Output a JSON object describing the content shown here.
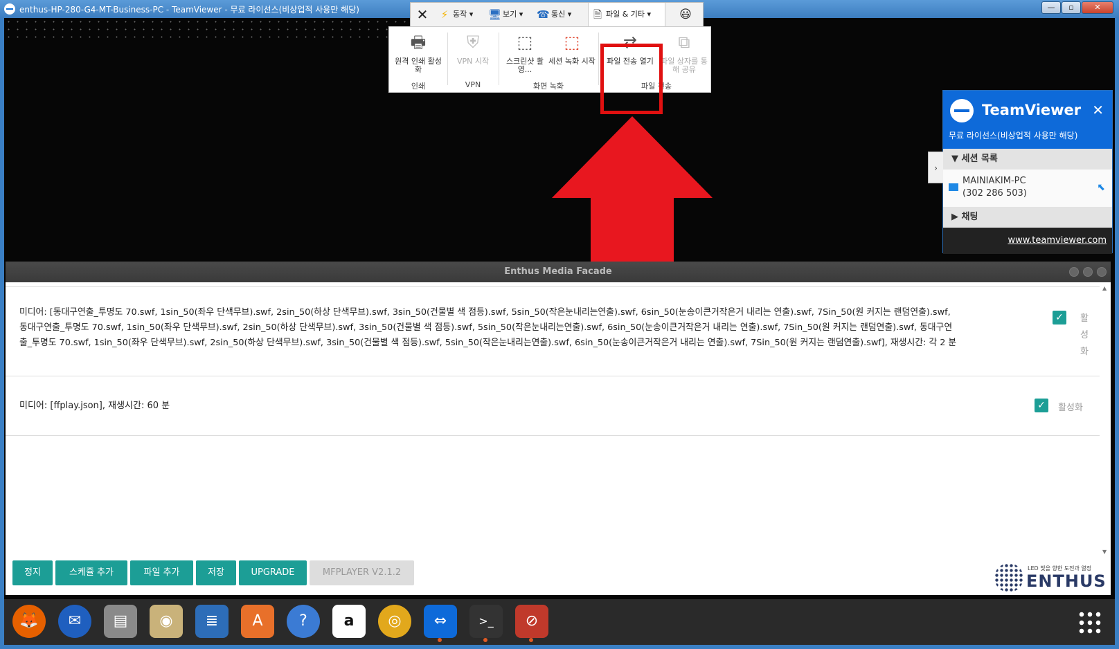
{
  "window": {
    "title": "enthus-HP-280-G4-MT-Business-PC - TeamViewer - 무료 라이선스(비상업적 사용만 해당)",
    "min_label": "—",
    "max_label": "▫",
    "close_label": "✕"
  },
  "toolbar": {
    "close_glyph": "✕",
    "items": [
      {
        "label": "동작",
        "icon": "lightning-icon"
      },
      {
        "label": "보기",
        "icon": "monitor-icon"
      },
      {
        "label": "통신",
        "icon": "phone-icon"
      },
      {
        "label": "파일 & 기타",
        "icon": "file-transfer-icon"
      }
    ],
    "emoji": "😃"
  },
  "ribbon": {
    "items": [
      {
        "label": "원격 인쇄 활성화",
        "icon": "printer-icon",
        "enabled": true
      },
      {
        "label": "VPN 시작",
        "icon": "vpn-shield-icon",
        "enabled": false
      },
      {
        "label": "스크린샷 촬영...",
        "icon": "screenshot-icon",
        "enabled": true
      },
      {
        "label": "세션 녹화 시작",
        "icon": "record-icon",
        "enabled": true
      },
      {
        "label": "파일 전송 열기",
        "icon": "file-transfer-open-icon",
        "enabled": true
      },
      {
        "label": "파일 상자를 통해 공유",
        "icon": "file-box-share-icon",
        "enabled": false
      }
    ],
    "groups": [
      "인쇄",
      "VPN",
      "화면 녹화",
      "파일 전송"
    ]
  },
  "tvpanel": {
    "brand": "TeamViewer",
    "license": "무료 라이선스(비상업적 사용만 해당)",
    "session_list_title": "세션 목록",
    "session_name": "MAINIAKIM-PC",
    "session_id": "(302 286 503)",
    "chat_title": "채팅",
    "url": "www.teamviewer.com"
  },
  "emf": {
    "title": "Enthus Media Facade",
    "rows": [
      {
        "lines": [
          "미디어: [동대구연출_투명도 70.swf, 1sin_50(좌우 단색무브).swf, 2sin_50(하상 단색무브).swf, 3sin_50(건물별 색 점등).swf, 5sin_50(작은눈내리는연출).swf, 6sin_50(눈송이큰거작은거 내리는 연출).swf, 7Sin_50(원 커지는 랜덤연출).swf,",
          "동대구연출_투명도 70.swf, 1sin_50(좌우 단색무브).swf, 2sin_50(하상 단색무브).swf, 3sin_50(건물별 색 점등).swf, 5sin_50(작은눈내리는연출).swf, 6sin_50(눈송이큰거작은거 내리는 연출).swf, 7Sin_50(원 커지는 랜덤연출).swf, 동대구연",
          "출_투명도 70.swf, 1sin_50(좌우 단색무브).swf, 2sin_50(하상 단색무브).swf, 3sin_50(건물별 색 점등).swf, 5sin_50(작은눈내리는연출).swf, 6sin_50(눈송이큰거작은거 내리는 연출).swf, 7Sin_50(원 커지는 랜덤연출).swf], 재생시간: 각 2 분"
        ],
        "active_label": [
          "활",
          "성",
          "화"
        ],
        "checked": true
      },
      {
        "lines": [
          "미디어: [ffplay.json], 재생시간: 60 분"
        ],
        "active_label": "활성화",
        "checked": true
      }
    ],
    "buttons": [
      "정지",
      "스케쥴 추가",
      "파일 추가",
      "저장",
      "UPGRADE"
    ],
    "version": "MFPLAYER V2.1.2",
    "logo_tagline": "LED 빛을 향한 도전과 열정",
    "logo_word": "ENTHUS"
  },
  "dock": {
    "apps": [
      {
        "name": "firefox-icon",
        "glyph": "🦊",
        "color": "#e66000"
      },
      {
        "name": "thunderbird-icon",
        "glyph": "✉",
        "color": "#1f5fbf"
      },
      {
        "name": "files-icon",
        "glyph": "▤",
        "color": "#8a8a8a"
      },
      {
        "name": "rhythmbox-icon",
        "glyph": "◉",
        "color": "#c9b27a"
      },
      {
        "name": "writer-icon",
        "glyph": "≣",
        "color": "#2d6db8"
      },
      {
        "name": "software-center-icon",
        "glyph": "A",
        "color": "#e8702a"
      },
      {
        "name": "help-icon",
        "glyph": "?",
        "color": "#3b7bd4"
      },
      {
        "name": "amazon-icon",
        "glyph": "a",
        "color": "#ffffff"
      },
      {
        "name": "chrome-icon",
        "glyph": "◎",
        "color": "#e2a81c"
      },
      {
        "name": "teamviewer-icon",
        "glyph": "⇔",
        "color": "#0e6ad9"
      },
      {
        "name": "terminal-icon",
        "glyph": ">_",
        "color": "#333333"
      },
      {
        "name": "no-entry-icon",
        "glyph": "⊘",
        "color": "#c0392b"
      }
    ]
  },
  "colors": {
    "accent": "#1c9e96",
    "teamviewer_blue": "#0e6ad9",
    "highlight_red": "#e01010"
  }
}
